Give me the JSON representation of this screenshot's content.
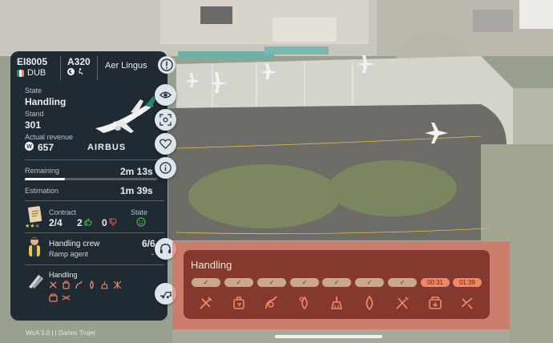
{
  "flight": {
    "number": "EI8005",
    "origin": "DUB",
    "aircraft_type": "A320",
    "airline": "Aer Lingus",
    "state_label": "State",
    "state": "Handling",
    "stand_label": "Stand",
    "stand": "301",
    "revenue_label": "Actual revenue",
    "revenue": "657",
    "manufacturer": "AIRBUS"
  },
  "timing": {
    "remaining_label": "Remaining",
    "remaining": "2m 13s",
    "remaining_progress": 0.3,
    "estimation_label": "Estimation",
    "estimation": "1m 39s"
  },
  "contract": {
    "label": "Contract",
    "value": "2/4",
    "likes": "2",
    "dislikes": "0",
    "state_label": "State",
    "stars_filled": 2,
    "stars_total": 3
  },
  "crew": {
    "label": "Handling crew",
    "count": "6/6",
    "role": "Ramp agent",
    "role_value": "-"
  },
  "handling_mini": {
    "label": "Handling"
  },
  "handling": {
    "title": "Handling",
    "tasks": [
      {
        "status": "✓",
        "icon": "catering-icon"
      },
      {
        "status": "✓",
        "icon": "baggage-icon"
      },
      {
        "status": "✓",
        "icon": "fuel-icon"
      },
      {
        "status": "✓",
        "icon": "water-icon"
      },
      {
        "status": "✓",
        "icon": "cleaning-icon"
      },
      {
        "status": "✓",
        "icon": "de-icing-icon"
      },
      {
        "status": "✓",
        "icon": "catering-tools-icon"
      },
      {
        "status": "00:31",
        "icon": "cargo-icon"
      },
      {
        "status": "01:39",
        "icon": "pushback-icon"
      }
    ]
  },
  "footer": "WoA 3.0 | | Darien Trujer",
  "colors": {
    "panel_bg": "#18222d",
    "handling_accent": "#f08a63",
    "done_pill": "#c9a98a",
    "aer_lingus_green": "#1c8a70"
  }
}
